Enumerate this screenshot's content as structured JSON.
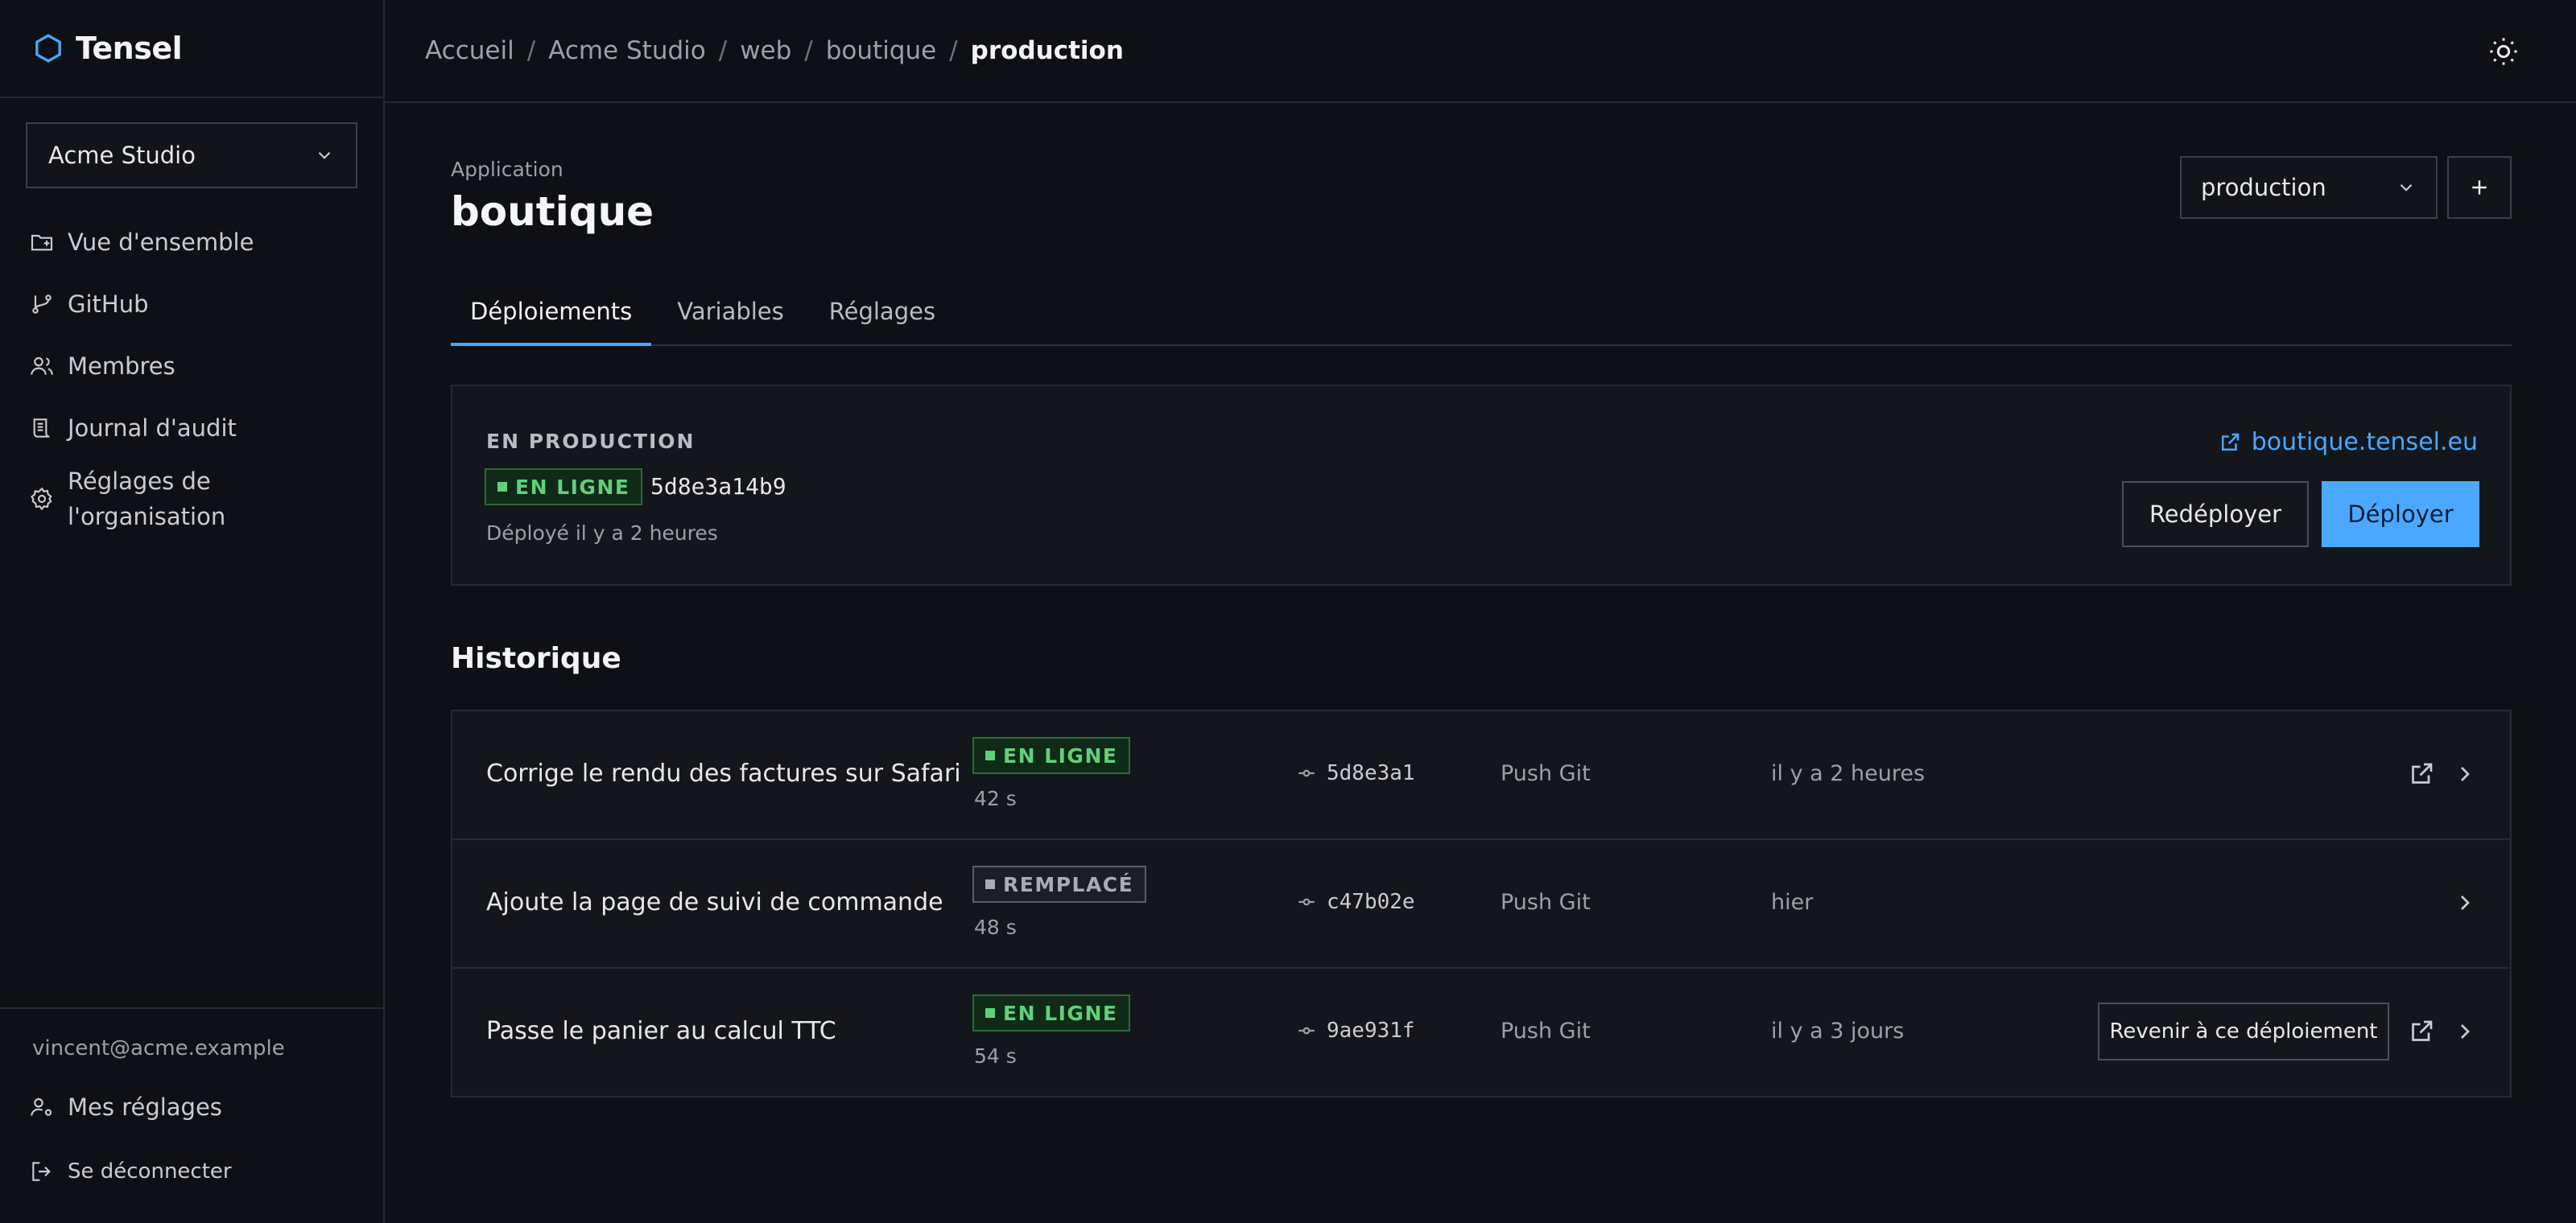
{
  "brand": {
    "name": "Tensel",
    "accent": "#4aa8ff"
  },
  "sidebar": {
    "org_selector": "Acme Studio",
    "items": [
      {
        "label": "Vue d'ensemble",
        "icon": "folder-icon"
      },
      {
        "label": "GitHub",
        "icon": "git-branch-icon"
      },
      {
        "label": "Membres",
        "icon": "users-icon"
      },
      {
        "label": "Journal d'audit",
        "icon": "scroll-icon"
      },
      {
        "label": "Réglages de l'organisation",
        "icon": "gear-icon"
      }
    ],
    "user_email": "vincent@acme.example",
    "my_settings": "Mes réglages",
    "logout": "Se déconnecter"
  },
  "breadcrumb": {
    "items": [
      "Accueil",
      "Acme Studio",
      "web",
      "boutique"
    ],
    "current": "production",
    "separator": "/"
  },
  "page": {
    "kicker": "Application",
    "title": "boutique",
    "env_selector": "production"
  },
  "tabs": [
    "Déploiements",
    "Variables",
    "Réglages"
  ],
  "production": {
    "label": "EN PRODUCTION",
    "status": "EN LIGNE",
    "hash": "5d8e3a14b9",
    "deployed": "Déployé il y a 2 heures",
    "url": "boutique.tensel.eu",
    "redeploy": "Redéployer",
    "deploy": "Déployer"
  },
  "history": {
    "title": "Historique",
    "revert_label": "Revenir à ce déploiement",
    "rows": [
      {
        "message": "Corrige le rendu des factures sur Safari",
        "status": "EN LIGNE",
        "duration": "42 s",
        "commit": "5d8e3a1",
        "source": "Push Git",
        "time": "il y a 2 heures"
      },
      {
        "message": "Ajoute la page de suivi de commande",
        "status": "REMPLACÉ",
        "duration": "48 s",
        "commit": "c47b02e",
        "source": "Push Git",
        "time": "hier"
      },
      {
        "message": "Passe le panier au calcul TTC",
        "status": "EN LIGNE",
        "duration": "54 s",
        "commit": "9ae931f",
        "source": "Push Git",
        "time": "il y a 3 jours"
      }
    ]
  },
  "colors": {
    "live": "#5fd17a",
    "primary": "#4aa8ff",
    "background": "#0d1014"
  }
}
